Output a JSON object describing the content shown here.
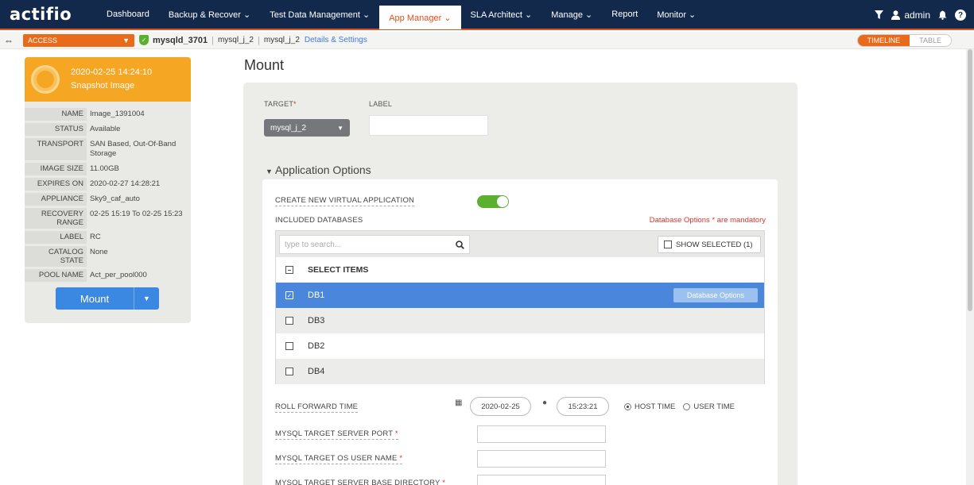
{
  "nav": {
    "logo": "actifio",
    "items": [
      {
        "label": "Dashboard"
      },
      {
        "label": "Backup & Recover ⌄"
      },
      {
        "label": "Test Data Management ⌄"
      },
      {
        "label": "App Manager ⌄"
      },
      {
        "label": "SLA Architect ⌄"
      },
      {
        "label": "Manage ⌄"
      },
      {
        "label": "Report"
      },
      {
        "label": "Monitor ⌄"
      }
    ],
    "user": "admin",
    "filter_icon": "filter-icon",
    "user_icon": "user-icon",
    "bell_icon": "bell-icon",
    "help_icon": "help-icon",
    "help_glyph": "?"
  },
  "subbar": {
    "access_label": "ACCESS",
    "app_name": "mysqld_3701",
    "crumb1": "mysql_j_2",
    "crumb2": "mysql_j_2",
    "details_link": "Details & Settings",
    "view_timeline": "TIMELINE",
    "view_table": "TABLE"
  },
  "image_card": {
    "datetime": "2020-02-25  14:24:10",
    "type": "Snapshot Image",
    "props": [
      {
        "key": "NAME",
        "value": "Image_1391004"
      },
      {
        "key": "STATUS",
        "value": "Available"
      },
      {
        "key": "TRANSPORT",
        "value": "SAN Based, Out-Of-Band Storage"
      },
      {
        "key": "IMAGE SIZE",
        "value": "11.00GB"
      },
      {
        "key": "EXPIRES ON",
        "value": "2020-02-27 14:28:21"
      },
      {
        "key": "APPLIANCE",
        "value": "Sky9_caf_auto"
      },
      {
        "key": "RECOVERY RANGE",
        "value": "02-25 15:19 To 02-25 15:23"
      },
      {
        "key": "LABEL",
        "value": "RC"
      },
      {
        "key": "CATALOG STATE",
        "value": "None"
      },
      {
        "key": "POOL NAME",
        "value": "Act_per_pool000"
      }
    ],
    "mount_button": "Mount"
  },
  "mount": {
    "title": "Mount",
    "target_label": "TARGET",
    "target_value": "mysql_j_2",
    "label_label": "LABEL",
    "label_value": "",
    "section_title": "Application Options",
    "create_virtual_app": "CREATE NEW VIRTUAL APPLICATION",
    "create_virtual_app_on": true,
    "included_databases": "INCLUDED DATABASES",
    "mandatory_note": "Database Options * are mandatory",
    "search_placeholder": "type to search...",
    "show_selected": "SHOW SELECTED (1)",
    "select_items": "SELECT ITEMS",
    "databases": [
      {
        "name": "DB1",
        "checked": true,
        "options_button": "Database Options"
      },
      {
        "name": "DB3",
        "checked": false
      },
      {
        "name": "DB2",
        "checked": false
      },
      {
        "name": "DB4",
        "checked": false
      }
    ],
    "roll_forward_label": "ROLL FORWARD TIME",
    "roll_date": "2020-02-25",
    "roll_time": "15:23:21",
    "host_time": "HOST TIME",
    "user_time": "USER TIME",
    "port_label": "MYSQL TARGET SERVER PORT",
    "os_user_label": "MYSQL TARGET OS USER NAME",
    "base_dir_label": "MYSQL TARGET SERVER BASE DIRECTORY"
  }
}
